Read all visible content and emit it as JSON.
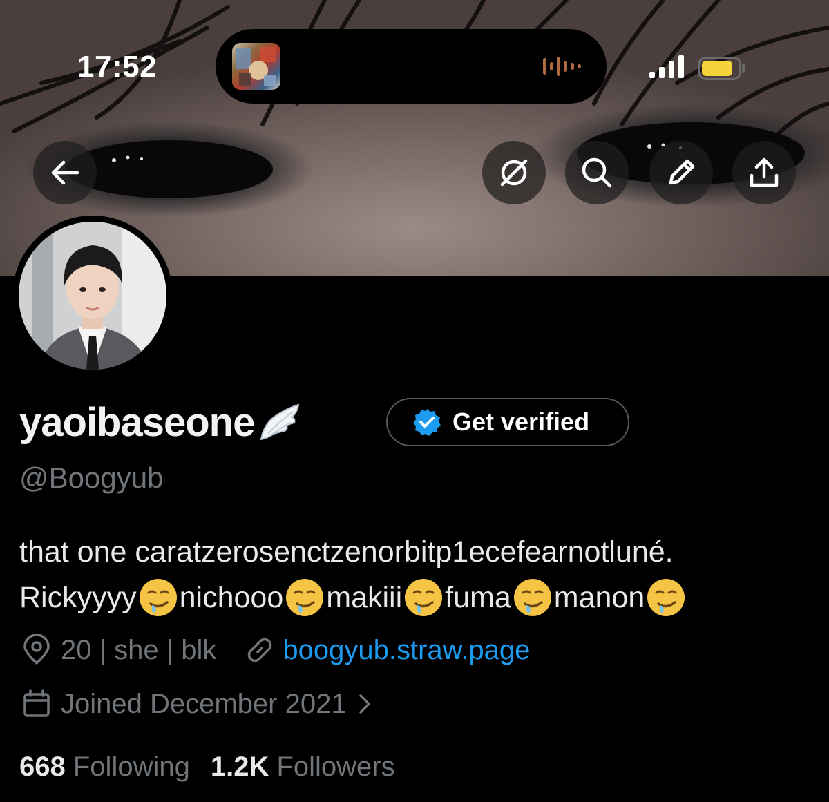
{
  "status_bar": {
    "time": "17:52"
  },
  "header": {
    "back_icon": "arrow-left-icon",
    "actions": [
      "explore-off-icon",
      "search-icon",
      "pen-icon",
      "share-icon"
    ]
  },
  "profile": {
    "display_name": "yaoibaseone",
    "name_emoji": "wing-icon",
    "handle": "@Boogyub",
    "verify_button": "Get verified",
    "bio_line1": "that one caratzerosenctzenorbitp1ecefearnotluné.",
    "bio_line2": [
      {
        "text": "Rickyyyy"
      },
      {
        "text": "nichooo"
      },
      {
        "text": "makiii"
      },
      {
        "text": "fuma"
      },
      {
        "text": "manon"
      }
    ],
    "location": "20 | she | blk",
    "website": "boogyub.straw.page",
    "joined": "Joined December 2021",
    "following_count": "668",
    "following_label": "Following",
    "followers_count": "1.2K",
    "followers_label": "Followers"
  },
  "colors": {
    "link": "#1d9bf0",
    "muted": "#71767b",
    "battery": "#f5d33a"
  }
}
